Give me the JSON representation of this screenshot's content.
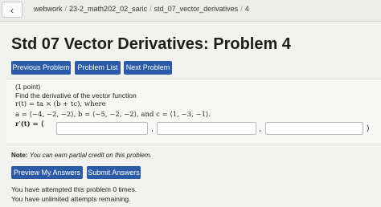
{
  "breadcrumb": {
    "items": [
      "webwork",
      "23-2_math202_02_saric",
      "std_07_vector_derivatives",
      "4"
    ],
    "separator": "/"
  },
  "icons": {
    "back": "chevron-left-icon"
  },
  "page_title": "Std 07 Vector Derivatives: Problem 4",
  "nav_buttons": {
    "previous": "Previous Problem",
    "list": "Problem List",
    "next": "Next Problem"
  },
  "problem": {
    "points": "(1 point)",
    "prompt": "Find the derivative of the vector function",
    "function_line": "r(t) = ta × (b + tc), where",
    "vectors_line": "a = ⟨−4, −2, −2⟩, b = ⟨−5, −2, −2⟩, and c = ⟨1, −3, −1⟩.",
    "answer_label": "r′(t) = ⟨",
    "answer_close": "⟩",
    "answer_separator": ",",
    "answer_values": [
      "",
      "",
      ""
    ]
  },
  "note": {
    "label": "Note:",
    "text": "You can earn partial credit on this problem."
  },
  "actions": {
    "preview": "Preview My Answers",
    "submit": "Submit Answers"
  },
  "status": {
    "attempted": "You have attempted this problem 0 times.",
    "remaining": "You have unlimited attempts remaining."
  },
  "colors": {
    "button": "#2b5aa6",
    "background": "#f2f2f0"
  }
}
